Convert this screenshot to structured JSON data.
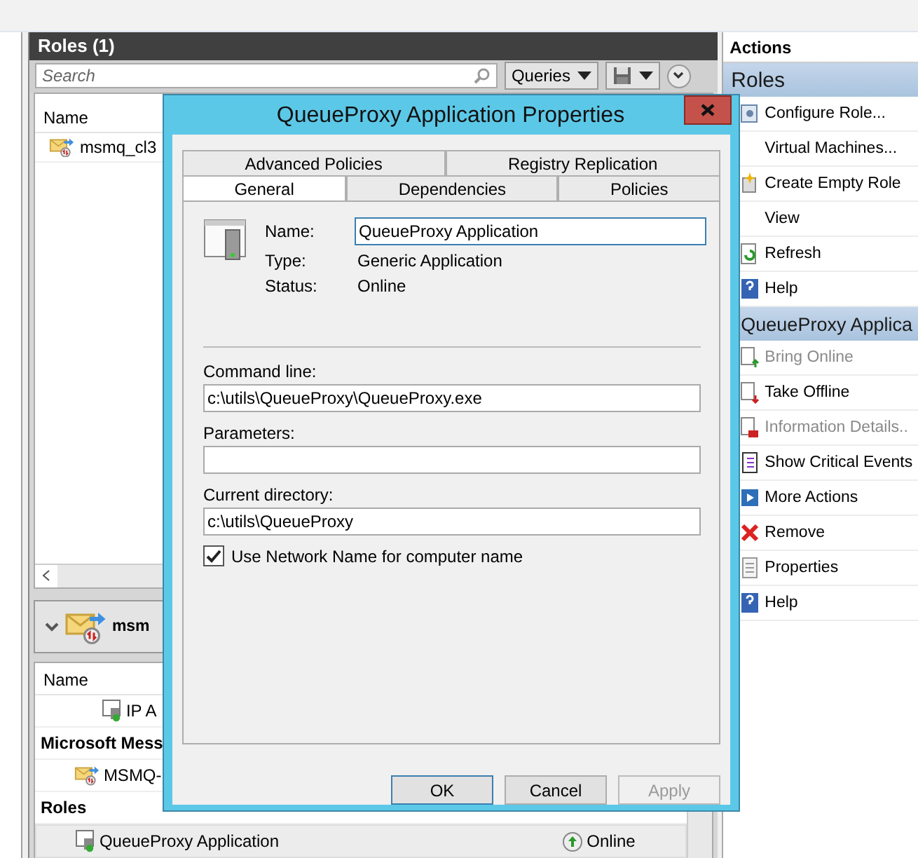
{
  "roles_panel": {
    "title": "Roles (1)",
    "search": {
      "placeholder": "Search"
    },
    "queries_button": "Queries",
    "list": {
      "columns": [
        "Name"
      ],
      "rows": [
        {
          "name": "msmq_cl3",
          "selected": false
        }
      ]
    }
  },
  "details_panel": {
    "title": "msm",
    "columns": [
      "Name"
    ],
    "rows": [
      {
        "kind": "address",
        "name": "IP A",
        "selected": false
      },
      {
        "kind": "group",
        "name": "Microsoft Mess",
        "selected": false
      },
      {
        "kind": "resource",
        "name": "MSMQ-",
        "selected": false
      },
      {
        "kind": "group",
        "name": "Roles",
        "selected": false
      },
      {
        "kind": "resource",
        "name": "QueueProxy Application",
        "status": "Online",
        "selected": true
      }
    ]
  },
  "actions_panel": {
    "title": "Actions",
    "groups": [
      {
        "title": "Roles",
        "items": [
          {
            "label": "Configure Role...",
            "disabled": false
          },
          {
            "label": "Virtual Machines...",
            "disabled": false
          },
          {
            "label": "Create Empty Role",
            "disabled": false
          },
          {
            "label": "View",
            "disabled": false
          },
          {
            "label": "Refresh",
            "disabled": false
          },
          {
            "label": "Help",
            "disabled": false
          }
        ]
      },
      {
        "title": "QueueProxy Applica",
        "items": [
          {
            "label": "Bring Online",
            "disabled": true
          },
          {
            "label": "Take Offline",
            "disabled": false
          },
          {
            "label": "Information Details..",
            "disabled": true
          },
          {
            "label": "Show Critical Events",
            "disabled": false
          },
          {
            "label": "More Actions",
            "disabled": false
          },
          {
            "label": "Remove",
            "disabled": false
          },
          {
            "label": "Properties",
            "disabled": false
          },
          {
            "label": "Help",
            "disabled": false
          }
        ]
      }
    ]
  },
  "dialog": {
    "title": "QueueProxy Application Properties",
    "tab_rows": [
      [
        {
          "label": "Advanced Policies",
          "selected": false
        },
        {
          "label": "Registry Replication",
          "selected": false
        }
      ],
      [
        {
          "label": "General",
          "selected": true
        },
        {
          "label": "Dependencies",
          "selected": false
        },
        {
          "label": "Policies",
          "selected": false
        }
      ]
    ],
    "general": {
      "name_label": "Name:",
      "name_value": "QueueProxy Application",
      "type_label": "Type:",
      "type_value": "Generic Application",
      "status_label": "Status:",
      "status_value": "Online",
      "fields": [
        {
          "label": "Command line:",
          "value": "c:\\utils\\QueueProxy\\QueueProxy.exe"
        },
        {
          "label": "Parameters:"
        },
        {
          "label": "Current directory:",
          "value": "c:\\utils\\QueueProxy"
        }
      ],
      "checkbox": {
        "label": "Use Network Name for computer name",
        "checked": true
      }
    },
    "buttons": [
      {
        "label": "OK",
        "kind": "default",
        "disabled": false
      },
      {
        "label": "Cancel",
        "kind": "normal",
        "disabled": false
      },
      {
        "label": "Apply",
        "kind": "normal",
        "disabled": true
      }
    ]
  }
}
